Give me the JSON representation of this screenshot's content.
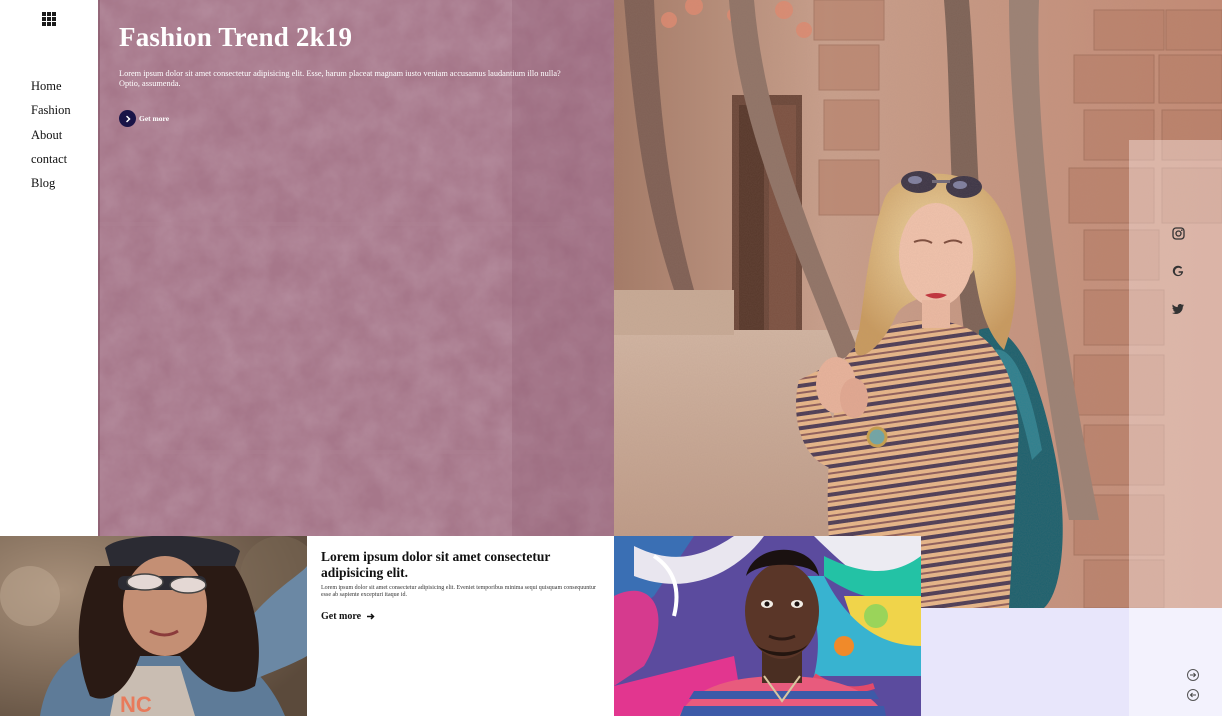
{
  "sidebar": {
    "menu_icon": "grid-icon",
    "nav": [
      "Home",
      "Fashion",
      "About",
      "contact",
      "Blog"
    ]
  },
  "hero": {
    "title": "Fashion Trend 2k19",
    "text": "Lorem ipsum dolor sit amet consectetur adipisicing elit. Esse, harum placeat magnam iusto veniam accusamus laudantium illo nulla? Optio, assumenda.",
    "button_icon": "chevron-right-icon",
    "button_label": "Get more"
  },
  "social": [
    "instagram-icon",
    "google-icon",
    "twitter-icon"
  ],
  "card": {
    "title": "Lorem ipsum dolor sit amet consectetur adipisicing elit.",
    "text": "Lorem ipsum dolor sit amet consectetur adipisicing elit. Eveniet temporibus minima sequi quisquam consequuntur esse ab sapiente excepturi itaque id.",
    "link_label": "Get more",
    "link_icon": "arrow-right-icon"
  },
  "pager": [
    "arrow-right-icon",
    "arrow-left-icon"
  ],
  "colors": {
    "hero_bg": "#a0707f",
    "button_dark": "#1a1447",
    "lavender": "#e8e6fb",
    "lavender_light": "#f3f2fd"
  }
}
